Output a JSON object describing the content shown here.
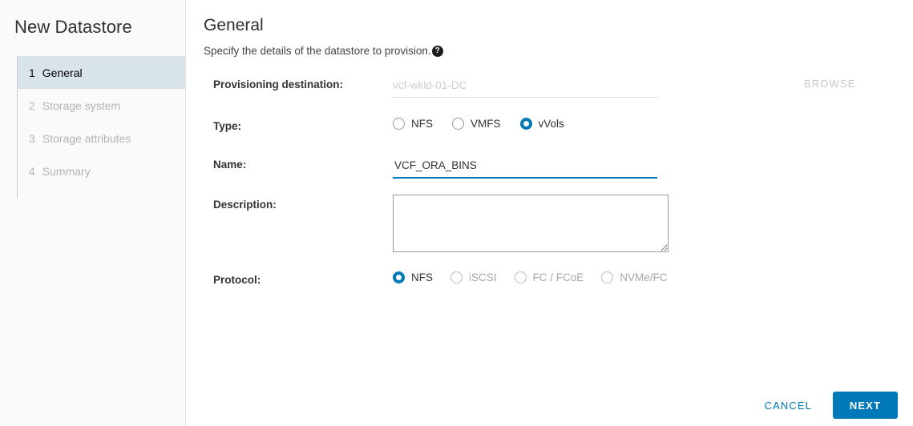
{
  "sidebar": {
    "title": "New Datastore",
    "items": [
      {
        "num": "1",
        "label": "General",
        "active": true
      },
      {
        "num": "2",
        "label": "Storage system",
        "active": false
      },
      {
        "num": "3",
        "label": "Storage attributes",
        "active": false
      },
      {
        "num": "4",
        "label": "Summary",
        "active": false
      }
    ]
  },
  "main": {
    "title": "General",
    "subtitle": "Specify the details of the datastore to provision.",
    "help_icon": "help-circle-icon",
    "help_glyph": "?"
  },
  "form": {
    "destination": {
      "label": "Provisioning destination:",
      "value": "",
      "placeholder": "vcf-wkld-01-DC",
      "browse_label": "BROWSE"
    },
    "type": {
      "label": "Type:",
      "options": [
        {
          "label": "NFS",
          "checked": false,
          "disabled": false
        },
        {
          "label": "VMFS",
          "checked": false,
          "disabled": false
        },
        {
          "label": "vVols",
          "checked": true,
          "disabled": false
        }
      ]
    },
    "name": {
      "label": "Name:",
      "value": "VCF_ORA_BINS",
      "placeholder": ""
    },
    "description": {
      "label": "Description:",
      "value": "",
      "placeholder": ""
    },
    "protocol": {
      "label": "Protocol:",
      "options": [
        {
          "label": "NFS",
          "checked": true,
          "disabled": false
        },
        {
          "label": "iSCSI",
          "checked": false,
          "disabled": true
        },
        {
          "label": "FC / FCoE",
          "checked": false,
          "disabled": true
        },
        {
          "label": "NVMe/FC",
          "checked": false,
          "disabled": true
        }
      ]
    }
  },
  "footer": {
    "cancel_label": "CANCEL",
    "next_label": "NEXT"
  },
  "colors": {
    "accent": "#0079b8",
    "active_nav_bg": "#d9e4ea",
    "sidebar_bg": "#fafafa",
    "disabled_text": "#a8a8a8"
  }
}
